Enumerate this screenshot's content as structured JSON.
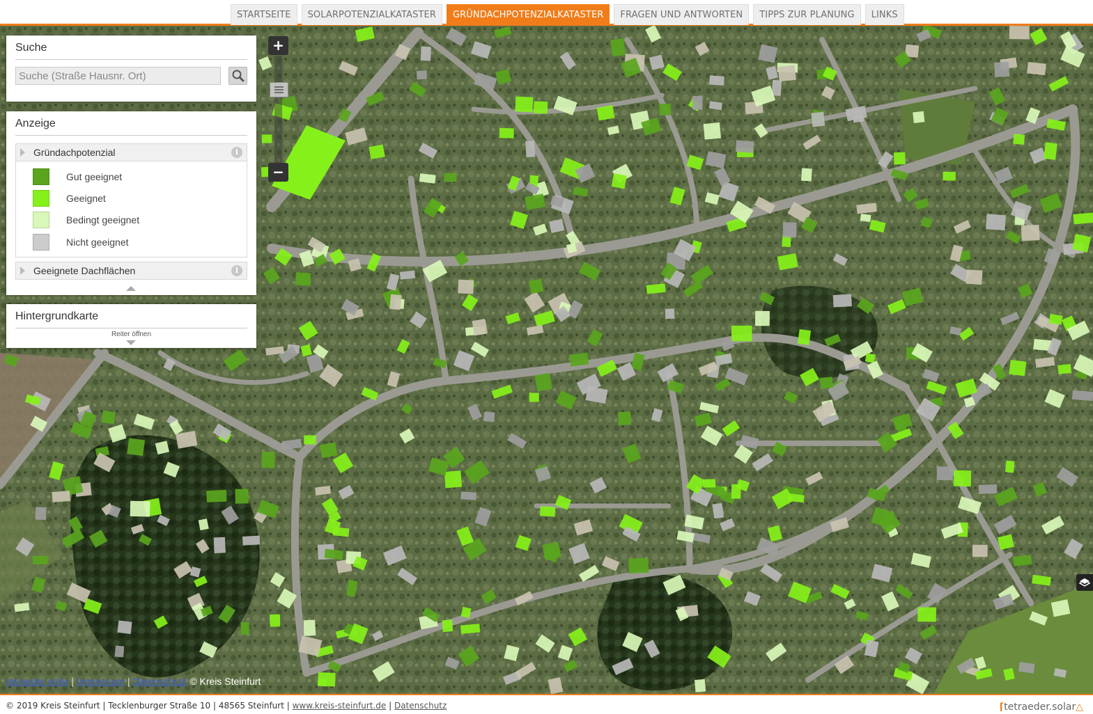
{
  "nav": {
    "tabs": [
      {
        "label": "STARTSEITE",
        "active": false
      },
      {
        "label": "SOLARPOTENZIALKATASTER",
        "active": false
      },
      {
        "label": "GRÜNDACHPOTENZIALKATASTER",
        "active": true
      },
      {
        "label": "FRAGEN UND ANTWORTEN",
        "active": false
      },
      {
        "label": "TIPPS ZUR PLANUNG",
        "active": false
      },
      {
        "label": "LINKS",
        "active": false
      }
    ]
  },
  "search": {
    "title": "Suche",
    "placeholder": "Suche (Straße Hausnr. Ort)",
    "button_icon": "magnifier-icon"
  },
  "display": {
    "title": "Anzeige",
    "section1": "Gründachpotenzial",
    "legend": [
      {
        "label": "Gut geeignet",
        "color": "#5aa51e"
      },
      {
        "label": "Geeignet",
        "color": "#86f11a"
      },
      {
        "label": "Bedingt geeignet",
        "color": "#d9f7b8"
      },
      {
        "label": "Nicht geeignet",
        "color": "#cccccc"
      }
    ],
    "section2": "Geeignete Dachflächen",
    "info_icon": "i"
  },
  "basemap": {
    "title": "Hintergrundkarte",
    "open_label": "Reiter öffnen"
  },
  "zoom": {
    "in": "+",
    "out": "−"
  },
  "attribution": {
    "link1": "tetraeder.solar",
    "link2": "Impressum",
    "link3": "Datenschutz",
    "copyright": "© Kreis Steinfurt"
  },
  "footer": {
    "text": "© 2019 Kreis Steinfurt | Tecklenburger Straße 10 | 48565 Steinfurt |",
    "link": "www.kreis-steinfurt.de",
    "sep": "|",
    "link2": "Datenschutz",
    "logo": "tetraeder.solar"
  }
}
